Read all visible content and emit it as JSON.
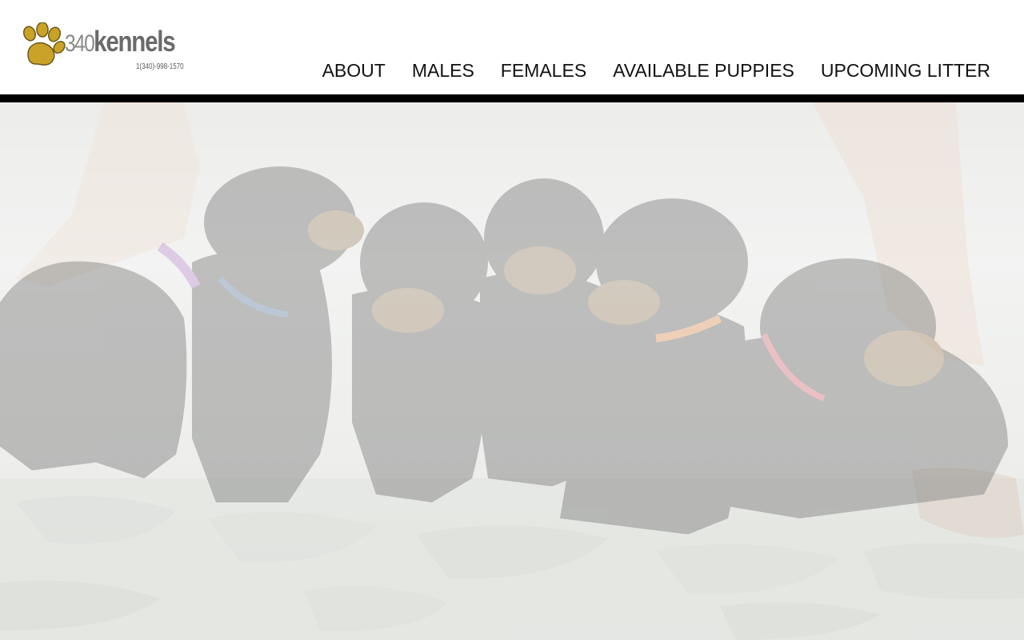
{
  "brand": {
    "name_number": "340",
    "name_word": "kennels",
    "phone": "1(340)-998-1570"
  },
  "nav": {
    "items": [
      {
        "label": "ABOUT"
      },
      {
        "label": "MALES"
      },
      {
        "label": "FEMALES"
      },
      {
        "label": "AVAILABLE PUPPIES"
      },
      {
        "label": "UPCOMING LITTER"
      }
    ]
  },
  "hero": {
    "image_subject": "rottweiler-puppies-photo"
  },
  "colors": {
    "divider": "#000000",
    "nav_text": "#111111",
    "logo_gold": "#c9a227",
    "logo_gray": "#6a6a6a"
  }
}
